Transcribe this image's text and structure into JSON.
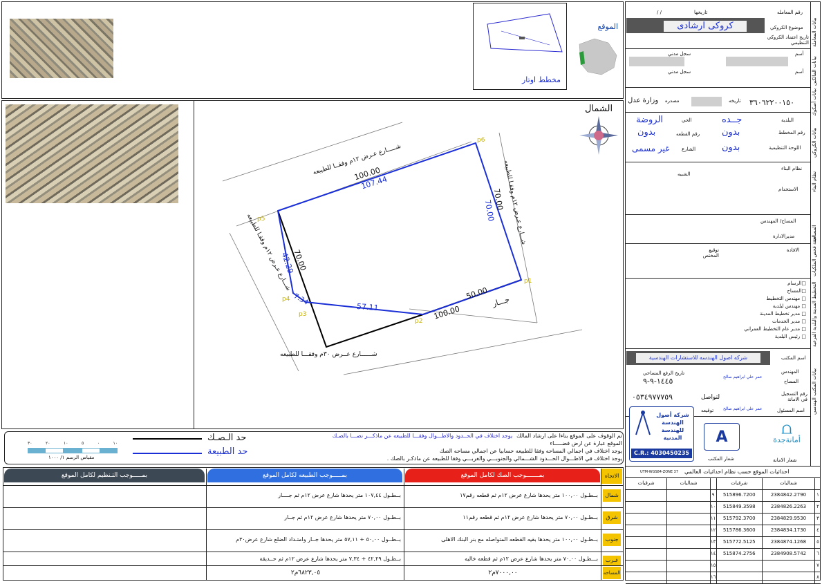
{
  "top_map": {
    "location_label": "الموقع",
    "otar_plan_label": "مخطط اوتار",
    "north_label": "الشمال"
  },
  "sketch": {
    "points": [
      "p1",
      "p2",
      "p3",
      "p4",
      "p5",
      "p6"
    ],
    "dimensions": {
      "north_outer": "100.00",
      "north_inner": "107.44",
      "east_outer": "70.00",
      "east_inner": "70.00",
      "south_right": "50.00",
      "south_total": "100.00",
      "south_inner": "57.11",
      "west_outer": "70.00",
      "west_inner": "42.29",
      "west_small": "7.34"
    },
    "streets": {
      "north": "شـــــارع عـرض ١٢م وفقــا للطبيعه",
      "east": "شـــارع عـرض ١٢م وفقـا للطبيعه",
      "west": "شـــارع عـرض ١٢م وفقـا للطبيعه",
      "south": "شــــــارع عــرض ٣٠م وفقـــا للطبيعه",
      "neighbor": "جـــار"
    }
  },
  "colors": {
    "deed_line": "#000000",
    "nature_line": "#1a2fd6",
    "deed_header": "#e8201a",
    "nature_header": "#2f6fe0",
    "plan_header": "#3d4855",
    "direction_bg": "#f5c400"
  },
  "legend": {
    "deed_line": "حد الـصـك",
    "nature_line": "حد الطبيعة",
    "scale_label": "مقياس الرسم ١/ ١٠٠٠",
    "scale_ticks": [
      "٣٠",
      "٢٠",
      "١٠",
      "٥",
      "٠",
      "١٠"
    ],
    "notes": [
      "تم الوقوف على الموقع بناءا على ارشاد المالك",
      "يوجد اختلاف في الحــدود والاطـــوال وفقـــا للطبيعه عن ماذكـــر نصـــا بالصـك",
      "الموقع عبارة عن ارض فضـــــاء",
      "يوجد اختلاف في اجمالي المساحه وفقا للطبيعه حسابيا عن اجمالي مساحه الصك",
      "يوجد اختلاف في الاطـــوال الحـــدود الشـــمالي والجنوبـــي والغربـــي وفقا للطبيعه عن ماذكـر بالصك ."
    ]
  },
  "boundary_table": {
    "header_direction": "الاتجاه",
    "header_deed": "بمـــــــوجب الصك لكامل الموقع",
    "header_nature": "بمـــــوجب الطبيعه لكامل الموقع",
    "header_plan": "بمـــــوجب التـنظيم لكامل الموقع",
    "rows": [
      {
        "dir": "شمال",
        "deed": "بــطـول ١٠٠,٠٠ متر يحدها شارع عرض ١٢م ثم قطعه رقم١٧",
        "nature": "بــطـول ١٠٧,٤٤ متر يحدها شارع عرض ١٢م ثم جــــار",
        "plan": ""
      },
      {
        "dir": "شرق",
        "deed": "بــطـول ٧٠,٠٠ متر يحدها   شارع عرض ١٢م ثم قطعه رقم١١",
        "nature": "بــطـول ٧٠,٠٠ متر يحدها   شارع عرض ١٢م ثم جــار",
        "plan": ""
      },
      {
        "dir": "جنوب",
        "deed": "بــطـول ١٠٠,٠٠ متر يحدها   بقيه القطعه المتواصله مع بنر البنك الاهلى",
        "nature": "بــطــول ٥٠,٠٠ + ٥٧,١١ متر يحدها جــار وامتـداد الضلع شارع عرض٣٠م",
        "plan": ""
      },
      {
        "dir": "غـرب",
        "deed": "بـــطـول ٧٠,٠٠ متر يحدها شارع عرض ١٢م ثم قطعه خاليه",
        "nature": "بــطـول ٤٢,٢٩ + ٧,٣٤ متر يحدها شارع عرض ١٢م ثم حــديقة",
        "plan": ""
      }
    ],
    "area_label": "المساحه",
    "area_deed": "٧٠٠٠,٠٠م٢",
    "area_nature": "٦٨٢٣,٠٥م٢",
    "area_plan": ""
  },
  "sidebar": {
    "transaction_section": "بيانات المعاملة",
    "transaction_no_label": "رقم المعامله",
    "date_label": "تاريخها",
    "date_value": "/     /",
    "subject_label": "موضوع الكروكي",
    "subject_value": "كروكى ارشادى",
    "approval_label": "تاريخ اعتماد الكروكي التنظيمي",
    "owner_section": "بيانات المالكين",
    "name_label": "أسم",
    "civil_label": "سجل مدني",
    "deed_section": "بيانات أصكوك",
    "deed_no": "٣٦٠٦٢٢٠٠١٥٠",
    "deed_date_label": "تاريخه",
    "source_label": "مصدره",
    "source_value": "وزارة عدل",
    "sketch_section": "بيانات الكروكي",
    "municipality_label": "البلدية",
    "municipality_value": "جــده",
    "district_label": "الحي",
    "district_value": "الروضة",
    "plan_no_label": "رقم المخطط",
    "plan_no_value": "بدون",
    "parcel_label": "رقم القطعه",
    "parcel_value": "بدون",
    "board_label": "اللوحة التنظيمية",
    "board_value": "بدون",
    "street_label": "الشارع",
    "street_value": "غير مسمى",
    "building_section": "نظام البناء",
    "building_system_label": "نظام البناء",
    "similar_label": "الشبيه",
    "usage_label": "الاستخدام",
    "survey_section": "المساحة",
    "surveyor_label": "المساح/ المهندس",
    "manager_label": "مديرالادارة",
    "ownership_section": "لجنة فحص الملكيات",
    "opinion_label": "الافادة",
    "official_sig_label": "توقيع المختص",
    "planning_section": "التخطيط المدينة والبلدية الفرعية",
    "planning_items": [
      "□الرسام",
      "□المساح",
      "□ مهندس التخطيط",
      "□ مهندس لبلدية",
      "□ مدير تخطيط المدينة",
      "□   مدير الخدمات",
      "□ مدير عام التخطيط العمراني",
      "□ رئيس البلدية"
    ],
    "office_section": "بيانات المكتب الهندسي",
    "office_name_label": "اسم المكتب",
    "office_name_value": "شركه اصول الهندسه للاستشارات الهندسية",
    "engineer_label": "المهندس",
    "survey_date_label": "تاريخ الرفع المساحي",
    "survey_date_value": "١٤٤٥-٩-٩",
    "surveyor2_label": "المساح",
    "surveyor_name": "عمر علي ابراهيم صالح",
    "reg_label": "رقم التسجيل في الامانة",
    "contact_label": "لتواصل",
    "contact_value": "٠٥٣٤٩٧٧٧٥٩",
    "responsible_label": "اسم المسئول",
    "signature_label": "توقيعه",
    "office_logo_label": "شعار المكتب",
    "amana_logo_label": "شعار الامانة",
    "amana_name": "أمانةجدة",
    "company_logo_text": "شركة أصول الهندسة للهندسة المدنية",
    "cr_text": "C.R.: 4030450235",
    "coords_section": "احداثيات الموقع حسب نظام احداثيات العالمي",
    "utm_label": "UTM-WGS84-ZONE 37",
    "coord_headers": [
      "شرقيات",
      "شماليات",
      "شرقيات",
      "شماليات"
    ],
    "coords": [
      {
        "n": "١",
        "north": "2384842.2790",
        "east": "515896.7200",
        "n2": "٩"
      },
      {
        "n": "٢",
        "north": "2384826.2263",
        "east": "515849.3598",
        "n2": "١٠"
      },
      {
        "n": "٣",
        "north": "2384829.9530",
        "east": "515792.3700",
        "n2": "١١"
      },
      {
        "n": "٤",
        "north": "2384834.1730",
        "east": "515786.3600",
        "n2": "١٢"
      },
      {
        "n": "٥",
        "north": "2384874.1268",
        "east": "515772.5125",
        "n2": "١٣"
      },
      {
        "n": "٦",
        "north": "2384908.5742",
        "east": "515874.2756",
        "n2": "١٤"
      },
      {
        "n": "٧",
        "north": "",
        "east": "",
        "n2": "١٥"
      },
      {
        "n": "٨",
        "north": "",
        "east": "",
        "n2": "١٦"
      }
    ]
  }
}
